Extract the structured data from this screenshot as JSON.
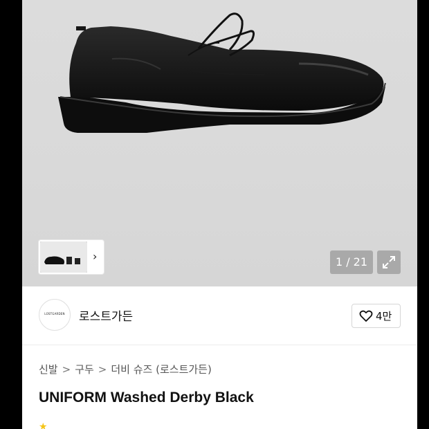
{
  "gallery": {
    "counter": "1 / 21",
    "thumb_next": "›"
  },
  "brand": {
    "logo_text": "LOSTGARDEN",
    "name": "로스트가든",
    "like_count": "4만"
  },
  "breadcrumb": [
    "신발",
    "구두",
    "더비 슈즈 (로스트가든)"
  ],
  "breadcrumb_sep": ">",
  "product": {
    "title": "UNIFORM Washed Derby Black"
  },
  "colors": {
    "image_bg": "#d9d9d9",
    "overlay": "#a9a9a9",
    "star": "#f5c518"
  }
}
